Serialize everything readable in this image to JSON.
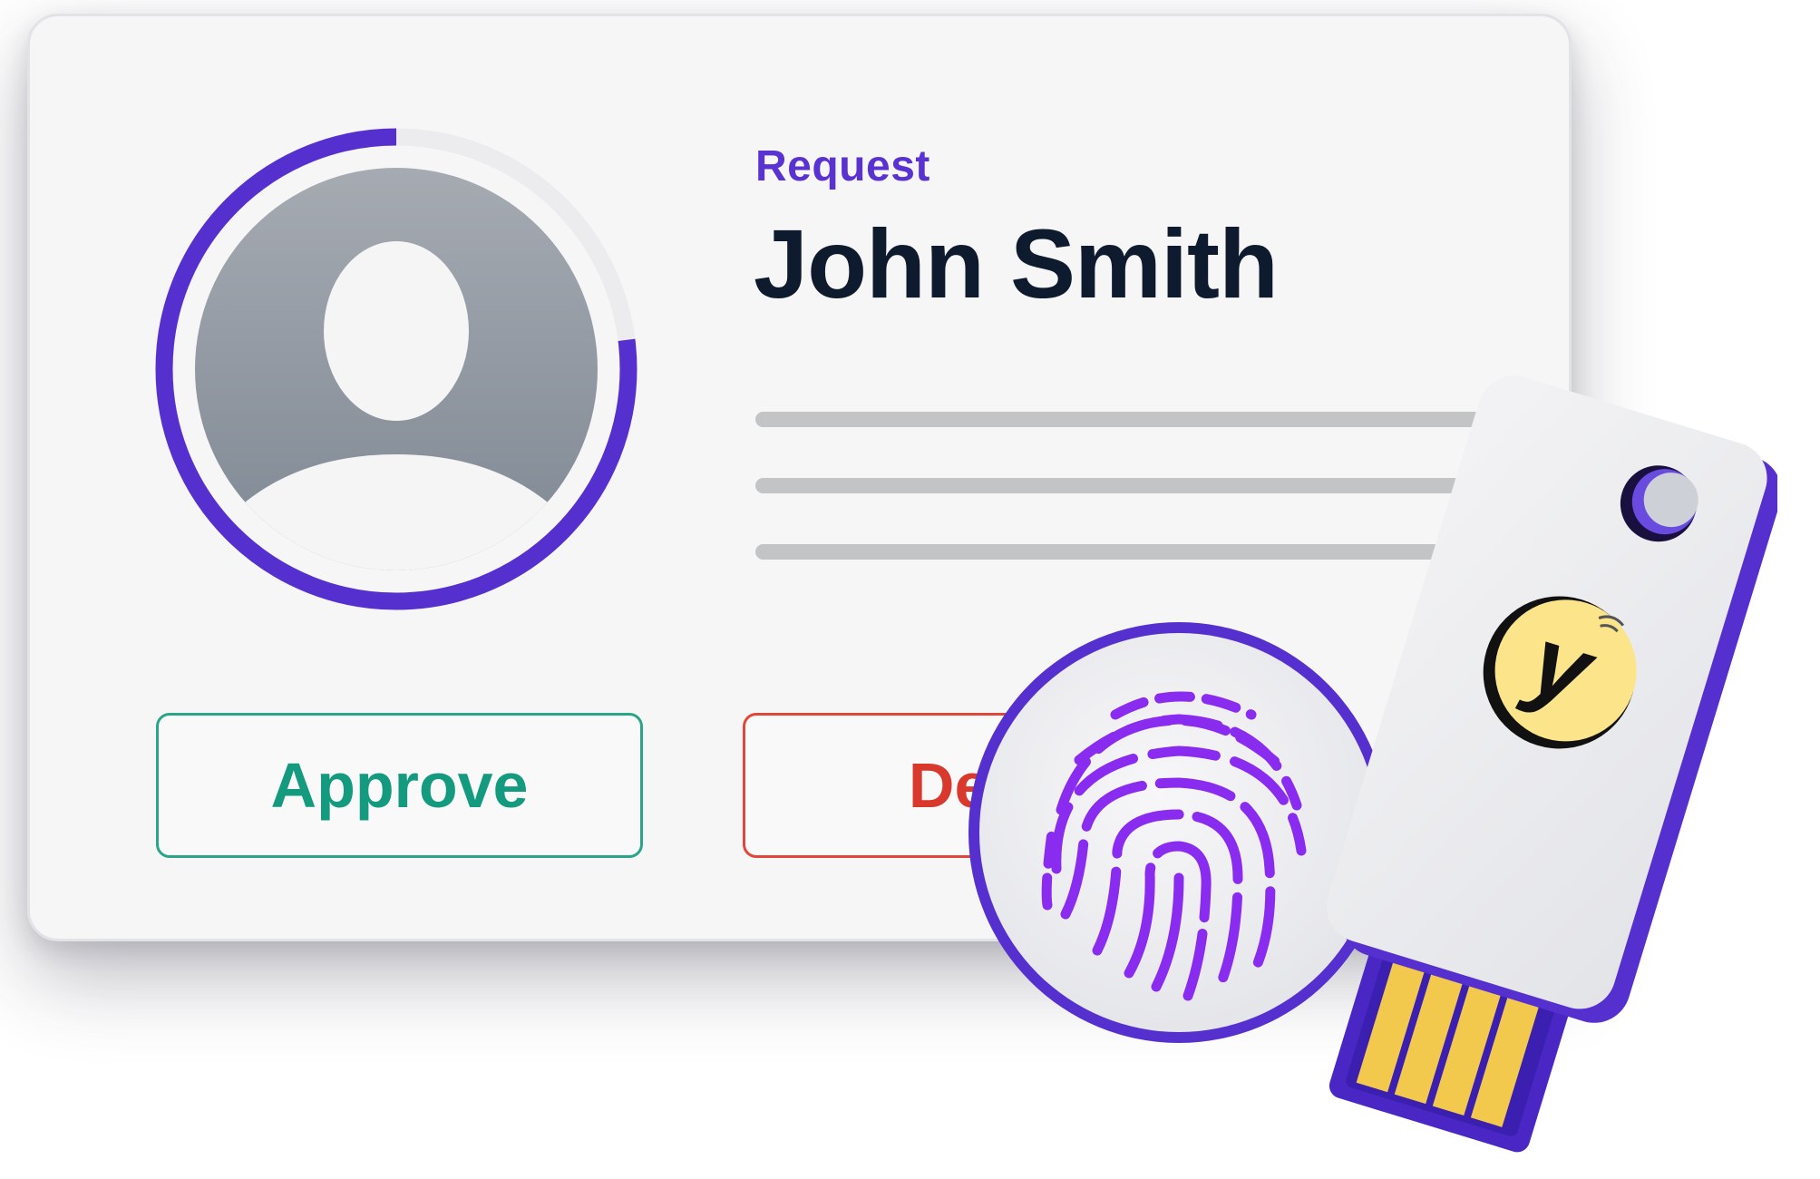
{
  "request": {
    "label": "Request",
    "name": "John Smith"
  },
  "avatar": {
    "icon": "user-avatar-icon",
    "progress_percent": 77
  },
  "actions": {
    "approve_label": "Approve",
    "deny_label": "Deny"
  },
  "overlays": {
    "fingerprint_icon": "fingerprint-icon",
    "security_key_icon": "usb-security-key-icon",
    "key_logo_text": "y"
  },
  "colors": {
    "accent": "#5a32d2",
    "approve": "#149a7e",
    "deny": "#d8392c",
    "title": "#0e1a2e",
    "key_logo": "#fbe48a",
    "usb_contacts": "#f2c94c"
  }
}
